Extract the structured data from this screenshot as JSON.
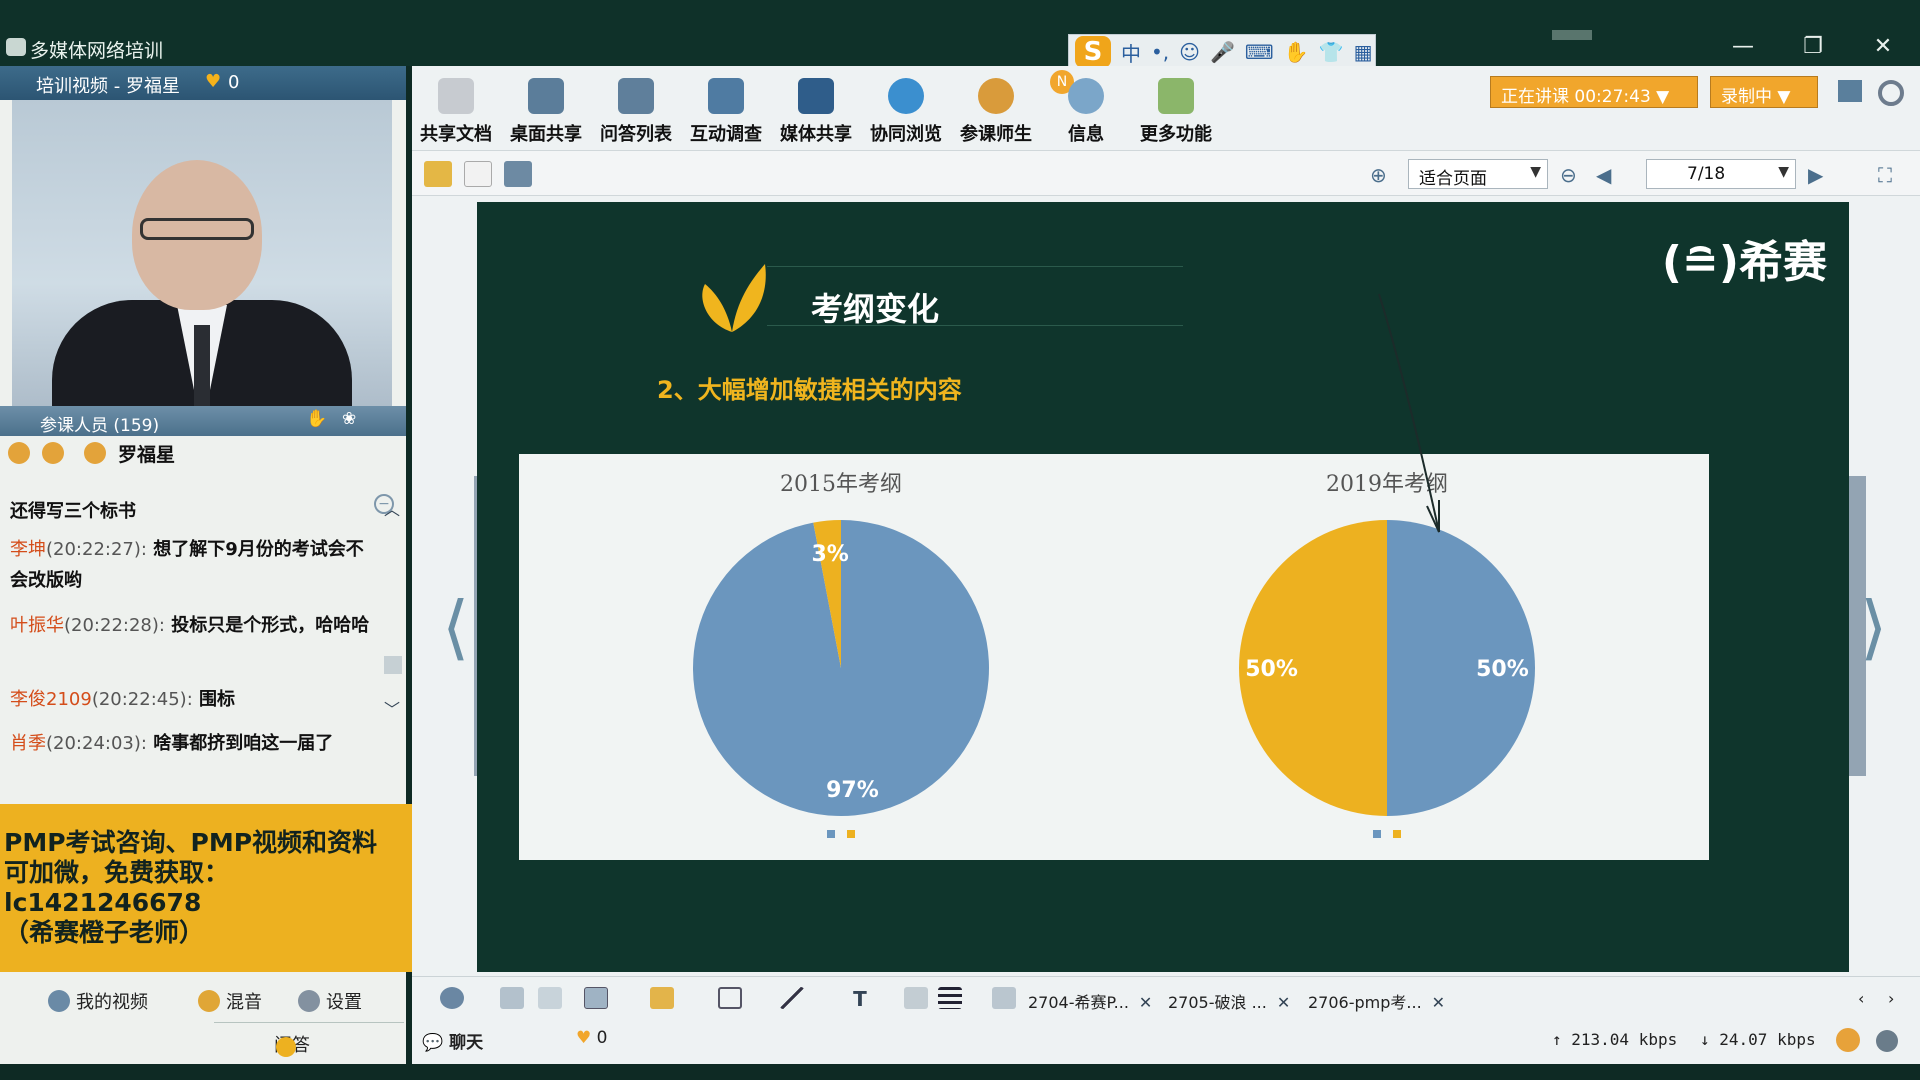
{
  "window": {
    "title": "多媒体网络培训",
    "controls": {
      "minimize": "—",
      "restore": "❐",
      "close": "✕"
    }
  },
  "ime": {
    "logo": "S",
    "label": "中"
  },
  "video_panel": {
    "title": "培训视频 - 罗福星",
    "heart_count": "0"
  },
  "participants": {
    "label": "参课人员 (159)",
    "presenter_name": "罗福星"
  },
  "chat": {
    "messages": [
      {
        "who": "",
        "time": "",
        "text": "还得写三个标书"
      },
      {
        "who": "李坤",
        "time": "(20:22:27):",
        "text": "想了解下9月份的考试会不会改版哟"
      },
      {
        "who": "叶振华",
        "time": "(20:22:28):",
        "text": "投标只是个形式，哈哈哈"
      },
      {
        "who": "李俊2109",
        "time": "(20:22:45):",
        "text": "围标"
      },
      {
        "who": "肖季",
        "time": "(20:24:03):",
        "text": "啥事都挤到咱这一届了"
      }
    ]
  },
  "ad": {
    "line1": "PMP考试咨询、PMP视频和资料",
    "line2": "可加微，免费获取：",
    "line3": "lc1421246678",
    "line4": "（希赛橙子老师）"
  },
  "bottom_left": {
    "my_video": "我的视频",
    "mix": "混音",
    "settings": "设置",
    "qa": "问答"
  },
  "toolbar": {
    "items": [
      "共享文档",
      "桌面共享",
      "问答列表",
      "互动调查",
      "媒体共享",
      "协同浏览",
      "参课师生",
      "信息",
      "更多功能"
    ],
    "badge": "N",
    "status_lecturing": "正在讲课 00:27:43 ▼",
    "status_recording": "录制中 ▼"
  },
  "toolbar2": {
    "zoom": "适合页面",
    "page": "7/18"
  },
  "slide": {
    "brand": "(≘)希赛",
    "title": "考纲变化",
    "subtitle": "2、大幅增加敏捷相关的内容"
  },
  "chart_data": [
    {
      "type": "pie",
      "title": "2015年考纲",
      "slices": [
        {
          "label": "97%",
          "value": 97,
          "color": "#6b96be"
        },
        {
          "label": "3%",
          "value": 3,
          "color": "#edb120"
        }
      ]
    },
    {
      "type": "pie",
      "title": "2019年考纲",
      "slices": [
        {
          "label": "50%",
          "value": 50,
          "color": "#6b96be"
        },
        {
          "label": "50%",
          "value": 50,
          "color": "#edb120"
        }
      ]
    }
  ],
  "doc_tabs": [
    "2704-希赛P...",
    "2705-破浪 ...",
    "2706-pmp考..."
  ],
  "statusbar": {
    "chat": "聊天",
    "heart_count": "0",
    "up_rate": "↑ 213.04 kbps",
    "down_rate": "↓ 24.07 kbps"
  }
}
